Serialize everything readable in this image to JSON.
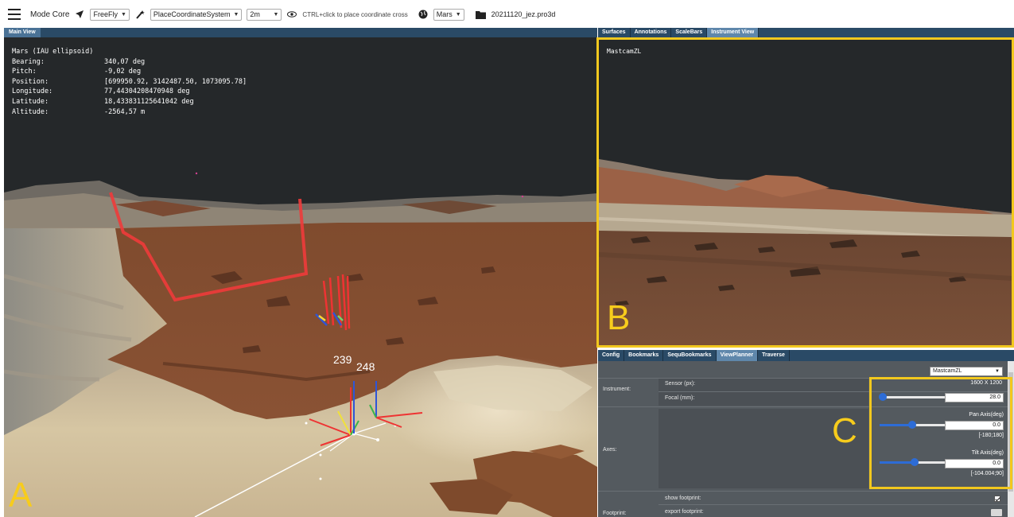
{
  "toolbar": {
    "mode_label": "Mode Core",
    "navigation_mode": "FreeFly",
    "tool": "PlaceCoordinateSystem",
    "size": "2m",
    "hint": "CTRL+click to place coordinate cross",
    "planet": "Mars",
    "project_file": "20211120_jez.pro3d"
  },
  "main_view": {
    "tab": "Main View",
    "readout": [
      {
        "key": "Mars (IAU ellipsoid)",
        "value": ""
      },
      {
        "key": "Bearing:",
        "value": "340,07 deg"
      },
      {
        "key": "Pitch:",
        "value": "-9,02 deg"
      },
      {
        "key": "Position:",
        "value": "[699950.92, 3142487.50, 1073095.78]"
      },
      {
        "key": "Longitude:",
        "value": "77,44304208470948 deg"
      },
      {
        "key": "Latitude:",
        "value": "18,433831125641042 deg"
      },
      {
        "key": "Altitude:",
        "value": "-2564,57 m"
      }
    ],
    "markers": [
      "239",
      "248"
    ],
    "label": "A"
  },
  "right_tabs": [
    "Surfaces",
    "Annotations",
    "ScaleBars",
    "Instrument View"
  ],
  "right_active_tab": 3,
  "instrument_view": {
    "camera_name": "MastcamZL",
    "label": "B"
  },
  "lower_tabs": [
    "Config",
    "Bookmarks",
    "SequBookmarks",
    "ViewPlanner",
    "Traverse"
  ],
  "lower_active_tab": 3,
  "planner": {
    "selected_instrument": "MastcamZL",
    "instrument_label": "Instrument:",
    "sensor_label": "Sensor (px):",
    "sensor_value": "1600 X 1200",
    "focal_label": "Focal (mm):",
    "focal_value": "28.0",
    "focal_fraction": 0.05,
    "axes_label": "Axes:",
    "pan_label": "Pan Axis(deg)",
    "pan_value": "0.0",
    "pan_range": "[-180;180]",
    "pan_fraction": 0.5,
    "tilt_label": "Tilt Axis(deg)",
    "tilt_value": "0.0",
    "tilt_range": "[-104.004;90]",
    "tilt_fraction": 0.54,
    "footprint_label": "Footprint:",
    "show_footprint_label": "show footprint:",
    "export_footprint_label": "export footprint:",
    "label": "C"
  },
  "colors": {
    "highlight": "#f2c81e",
    "header": "#2a4a66",
    "active_tab": "#5f87ab",
    "slider": "#2d6cd6"
  }
}
